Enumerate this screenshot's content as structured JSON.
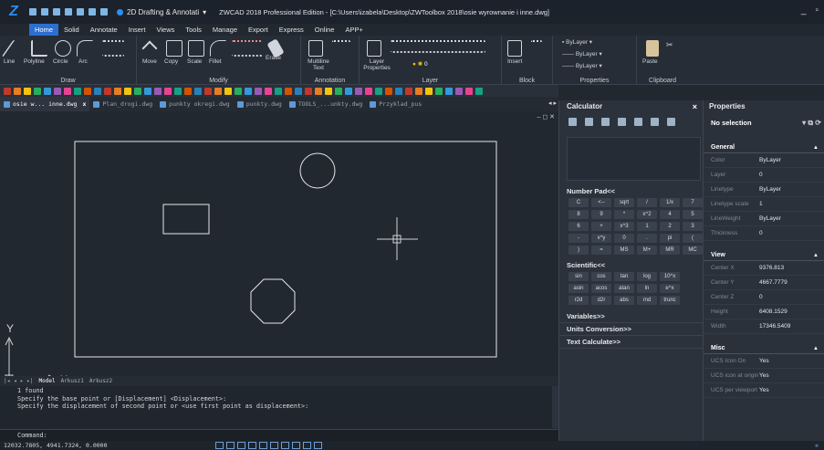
{
  "app": {
    "workspace": "2D Drafting & Annotati",
    "window_title": "ZWCAD 2018 Professional Edition - [C:\\Users\\izabela\\Desktop\\ZWToolbox 2018\\osie wyrownanie i inne.dwg]"
  },
  "menu": [
    "Home",
    "Solid",
    "Annotate",
    "Insert",
    "Views",
    "Tools",
    "Manage",
    "Export",
    "Express",
    "Online",
    "APP+"
  ],
  "ribbon": {
    "groups": [
      "Draw",
      "Modify",
      "Annotation",
      "Layer",
      "Block",
      "Properties",
      "Clipboard"
    ],
    "draw_items": [
      "Line",
      "Polyline",
      "Circle",
      "Arc"
    ],
    "modify_items": [
      "Move",
      "Copy",
      "Scale",
      "Fillet",
      "Erase"
    ],
    "annotation_items": [
      "Multiline Text"
    ],
    "layer_items": [
      "Layer Properties"
    ],
    "layer_value": "0",
    "block_items": [
      "Insert"
    ],
    "props_values": [
      "ByLayer",
      "ByLayer",
      "ByLayer"
    ],
    "clipboard_items": [
      "Paste"
    ]
  },
  "doc_tabs": [
    {
      "label": "osie w... inne.dwg",
      "close": "x"
    },
    {
      "label": "Plan_drogi.dwg"
    },
    {
      "label": "punkty okregi.dwg"
    },
    {
      "label": "punkty.dwg"
    },
    {
      "label": "TOOLS_...unkty.dwg"
    },
    {
      "label": "Przyklad_pus"
    }
  ],
  "canvas": {
    "ucs_y": "Y",
    "ucs_x": "X"
  },
  "layout_tabs": [
    "Model",
    "Arkusz1",
    "Arkusz2"
  ],
  "command": {
    "history": [
      "1 found",
      "Specify the base point or [Displacement] <Displacement>:",
      "Specify the displacement of second point or <use first point as displacement>:"
    ],
    "prompt": "Command:"
  },
  "status": {
    "coords": "12032.7805, 4941.7324, 0.0000"
  },
  "calculator": {
    "title": "Calculator",
    "number_pad": "Number Pad<<",
    "keys": [
      "C",
      "<--",
      "sqrt",
      "/",
      "1/x",
      "7",
      "8",
      "9",
      "*",
      "x^2",
      "4",
      "5",
      "6",
      "+",
      "x^3",
      "1",
      "2",
      "3",
      "-",
      "x^y",
      "0",
      ".",
      "pi",
      "(",
      ")",
      "=",
      "MS",
      "M+",
      "MR",
      "MC"
    ],
    "scientific": "Scientific<<",
    "sci_keys": [
      "sin",
      "cos",
      "tan",
      "log",
      "10^x",
      "asin",
      "acos",
      "atan",
      "ln",
      "e^x",
      "r2d",
      "d2r",
      "abs",
      "rnd",
      "trunc"
    ],
    "variables": "Variables>>",
    "units": "Units Conversion>>",
    "text_calc": "Text Calculate>>"
  },
  "properties": {
    "title": "Properties",
    "selection": "No selection",
    "general_label": "General",
    "general": [
      {
        "k": "Color",
        "v": "ByLayer"
      },
      {
        "k": "Layer",
        "v": "0"
      },
      {
        "k": "Linetype",
        "v": "ByLayer"
      },
      {
        "k": "Linetype scale",
        "v": "1"
      },
      {
        "k": "LineWeight",
        "v": "ByLayer"
      },
      {
        "k": "Thickness",
        "v": "0"
      }
    ],
    "view_label": "View",
    "view": [
      {
        "k": "Center X",
        "v": "9376.813"
      },
      {
        "k": "Center Y",
        "v": "4667.7779"
      },
      {
        "k": "Center Z",
        "v": "0"
      },
      {
        "k": "Height",
        "v": "6408.1529"
      },
      {
        "k": "Width",
        "v": "17346.5409"
      }
    ],
    "misc_label": "Misc",
    "misc": [
      {
        "k": "UCS Icon On",
        "v": "Yes"
      },
      {
        "k": "UCS icon at origin",
        "v": "Yes"
      },
      {
        "k": "UCS per viewport",
        "v": "Yes"
      }
    ]
  },
  "colors": {
    "accent": "#2d6fd0",
    "background": "#212830",
    "panel": "#2b323c"
  }
}
